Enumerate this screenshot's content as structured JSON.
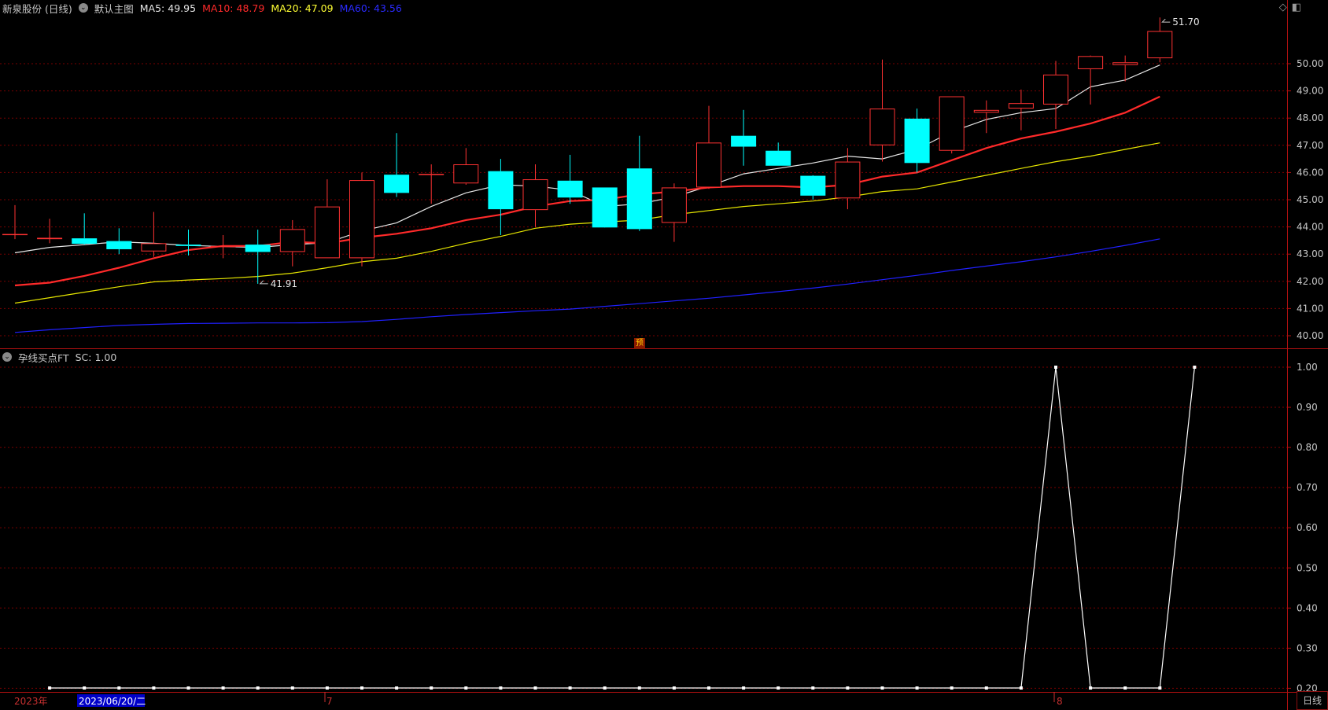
{
  "header": {
    "title": "新泉股份 (日线)",
    "main_label": "默认主图",
    "ma5": {
      "label": "MA5:",
      "value": "49.95",
      "color": "#e6e6e6"
    },
    "ma10": {
      "label": "MA10:",
      "value": "48.79",
      "color": "#ff2a2a"
    },
    "ma20": {
      "label": "MA20:",
      "value": "47.09",
      "color": "#ffff33"
    },
    "ma60": {
      "label": "MA60:",
      "value": "43.56",
      "color": "#2a2aff"
    }
  },
  "indicator_header": {
    "name": "孕线买点FT",
    "sc_label": "SC:",
    "sc_value": "1.00"
  },
  "x_axis": {
    "year_label": "2023年",
    "date_label": "2023/06/20/二",
    "month_7": "7",
    "month_8": "8"
  },
  "period_button": "日线",
  "pre_badge": "预",
  "icons": {
    "diamond": "diamond-icon",
    "window": "window-icon"
  },
  "chart_data": [
    {
      "type": "candlestick",
      "ylim": [
        39.85,
        52.6
      ],
      "yticks": [
        "40.00",
        "41.00",
        "42.00",
        "43.00",
        "44.00",
        "45.00",
        "46.00",
        "47.00",
        "48.00",
        "49.00",
        "50.00"
      ],
      "up_color": "#ff3232",
      "down_color": "#00ffff",
      "candles": [
        {
          "o": 43.74,
          "h": 44.8,
          "l": 43.55,
          "c": 43.74
        },
        {
          "o": 43.55,
          "h": 44.3,
          "l": 43.4,
          "c": 43.6
        },
        {
          "o": 43.58,
          "h": 44.5,
          "l": 43.35,
          "c": 43.38
        },
        {
          "o": 43.48,
          "h": 43.95,
          "l": 43.0,
          "c": 43.18
        },
        {
          "o": 43.1,
          "h": 44.55,
          "l": 42.9,
          "c": 43.4
        },
        {
          "o": 43.35,
          "h": 43.9,
          "l": 42.95,
          "c": 43.3
        },
        {
          "o": 43.3,
          "h": 43.7,
          "l": 42.85,
          "c": 43.3
        },
        {
          "o": 43.35,
          "h": 43.9,
          "l": 41.91,
          "c": 43.08
        },
        {
          "o": 43.08,
          "h": 44.25,
          "l": 42.55,
          "c": 43.92
        },
        {
          "o": 42.85,
          "h": 45.75,
          "l": 42.85,
          "c": 44.75
        },
        {
          "o": 42.85,
          "h": 46.0,
          "l": 42.55,
          "c": 45.72
        },
        {
          "o": 45.92,
          "h": 47.45,
          "l": 45.1,
          "c": 45.25
        },
        {
          "o": 45.92,
          "h": 46.3,
          "l": 44.85,
          "c": 45.95
        },
        {
          "o": 45.6,
          "h": 46.9,
          "l": 45.55,
          "c": 46.3
        },
        {
          "o": 46.05,
          "h": 46.5,
          "l": 43.7,
          "c": 44.65
        },
        {
          "o": 44.62,
          "h": 46.3,
          "l": 44.0,
          "c": 45.75
        },
        {
          "o": 45.7,
          "h": 46.65,
          "l": 44.85,
          "c": 45.08
        },
        {
          "o": 45.45,
          "h": 45.45,
          "l": 44.0,
          "c": 43.98
        },
        {
          "o": 46.15,
          "h": 47.35,
          "l": 43.85,
          "c": 43.92
        },
        {
          "o": 44.15,
          "h": 45.6,
          "l": 43.45,
          "c": 45.45
        },
        {
          "o": 45.45,
          "h": 48.45,
          "l": 45.4,
          "c": 47.1
        },
        {
          "o": 47.35,
          "h": 48.3,
          "l": 46.25,
          "c": 46.95
        },
        {
          "o": 46.8,
          "h": 47.1,
          "l": 46.25,
          "c": 46.25
        },
        {
          "o": 45.88,
          "h": 45.9,
          "l": 45.0,
          "c": 45.15
        },
        {
          "o": 45.05,
          "h": 46.9,
          "l": 44.65,
          "c": 46.4
        },
        {
          "o": 47.0,
          "h": 50.15,
          "l": 46.4,
          "c": 48.35
        },
        {
          "o": 47.98,
          "h": 48.35,
          "l": 46.0,
          "c": 46.35
        },
        {
          "o": 46.8,
          "h": 48.8,
          "l": 46.7,
          "c": 48.8
        },
        {
          "o": 48.2,
          "h": 48.65,
          "l": 47.45,
          "c": 48.3
        },
        {
          "o": 48.35,
          "h": 49.05,
          "l": 47.55,
          "c": 48.55
        },
        {
          "o": 48.5,
          "h": 50.1,
          "l": 47.6,
          "c": 49.6
        },
        {
          "o": 49.8,
          "h": 50.3,
          "l": 48.5,
          "c": 50.28
        },
        {
          "o": 49.95,
          "h": 50.3,
          "l": 49.35,
          "c": 50.05
        },
        {
          "o": 50.2,
          "h": 51.7,
          "l": 50.05,
          "c": 51.2
        }
      ],
      "ma_lines": [
        {
          "name": "MA5",
          "color": "#e6e6e6",
          "width": 1.2,
          "values": [
            43.05,
            43.25,
            43.35,
            43.45,
            43.4,
            43.32,
            43.28,
            43.25,
            43.35,
            43.42,
            43.85,
            44.15,
            44.75,
            45.25,
            45.55,
            45.5,
            45.35,
            44.75,
            44.85,
            45.1,
            45.5,
            45.95,
            46.15,
            46.35,
            46.6,
            46.5,
            46.85,
            47.5,
            47.95,
            48.2,
            48.35,
            49.15,
            49.4,
            49.95
          ]
        },
        {
          "name": "MA10",
          "color": "#ff2a2a",
          "width": 2.2,
          "values": [
            41.85,
            41.95,
            42.2,
            42.5,
            42.85,
            43.15,
            43.3,
            43.3,
            43.45,
            43.4,
            43.6,
            43.75,
            43.95,
            44.25,
            44.45,
            44.75,
            44.95,
            45.0,
            45.2,
            45.3,
            45.45,
            45.5,
            45.5,
            45.45,
            45.55,
            45.85,
            46.0,
            46.45,
            46.9,
            47.25,
            47.5,
            47.8,
            48.2,
            48.79
          ]
        },
        {
          "name": "MA20",
          "color": "#e6e600",
          "width": 1.2,
          "values": [
            41.2,
            41.4,
            41.6,
            41.8,
            41.98,
            42.05,
            42.1,
            42.18,
            42.3,
            42.5,
            42.72,
            42.85,
            43.1,
            43.4,
            43.65,
            43.95,
            44.1,
            44.18,
            44.25,
            44.45,
            44.6,
            44.75,
            44.85,
            44.95,
            45.1,
            45.3,
            45.4,
            45.65,
            45.9,
            46.15,
            46.4,
            46.6,
            46.85,
            47.09
          ]
        },
        {
          "name": "MA60",
          "color": "#2020ff",
          "width": 1.2,
          "values": [
            40.12,
            40.22,
            40.3,
            40.38,
            40.42,
            40.45,
            40.46,
            40.47,
            40.47,
            40.48,
            40.52,
            40.6,
            40.7,
            40.78,
            40.85,
            40.92,
            40.98,
            41.08,
            41.18,
            41.28,
            41.38,
            41.5,
            41.62,
            41.75,
            41.9,
            42.06,
            42.22,
            42.4,
            42.56,
            42.72,
            42.9,
            43.1,
            43.32,
            43.56
          ]
        }
      ],
      "annotations": [
        {
          "candle": 33,
          "label": "51.70"
        },
        {
          "candle": 7,
          "label": "41.91"
        }
      ]
    },
    {
      "type": "line",
      "name": "SC",
      "ylim": [
        0,
        1.05
      ],
      "yticks": [
        "0.20",
        "0.30",
        "0.40",
        "0.50",
        "0.60",
        "0.70",
        "0.80",
        "0.90",
        "1.00"
      ],
      "color": "#ffffff",
      "values": [
        0,
        0,
        0,
        0,
        0,
        0,
        0,
        0,
        0,
        0,
        0,
        0,
        0,
        0,
        0,
        0,
        0,
        0,
        0,
        0,
        0,
        0,
        0,
        0,
        0,
        0,
        0,
        0,
        0,
        1,
        0,
        0,
        0,
        1
      ]
    }
  ]
}
